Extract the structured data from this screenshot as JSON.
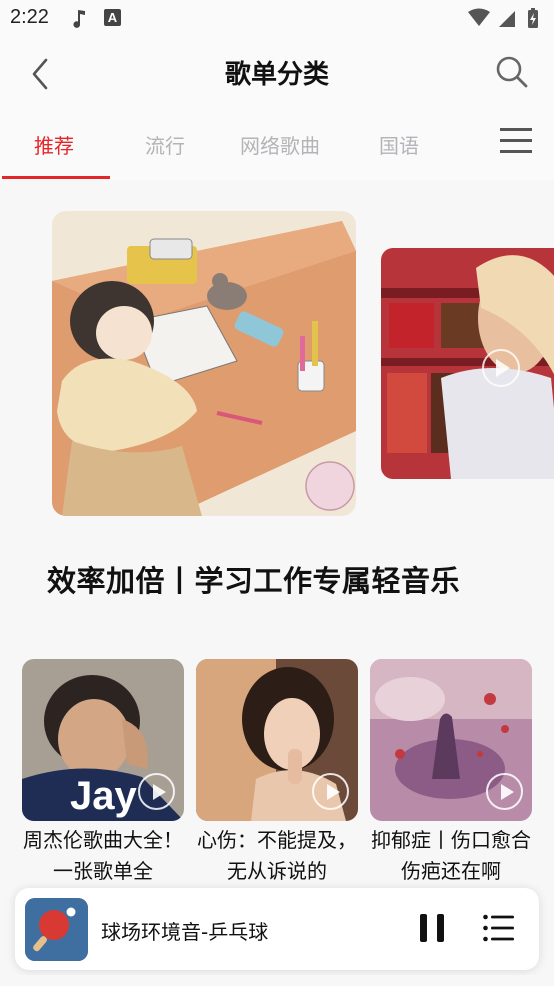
{
  "status_bar": {
    "time": "2:22",
    "badge": "A"
  },
  "header": {
    "title": "歌单分类"
  },
  "tabs": [
    {
      "label": "推荐",
      "active": true
    },
    {
      "label": "流行",
      "active": false
    },
    {
      "label": "网络歌曲",
      "active": false
    },
    {
      "label": "国语",
      "active": false
    }
  ],
  "banner": {
    "caption": "效率加倍丨学习工作专属轻音乐"
  },
  "playlists": [
    {
      "title": "周杰伦歌曲大全！一张歌单全"
    },
    {
      "title": "心伤：不能提及，无从诉说的"
    },
    {
      "title": "抑郁症丨伤口愈合伤疤还在啊"
    }
  ],
  "player": {
    "track": "球场环境音-乒乓球"
  },
  "colors": {
    "accent": "#e4262b",
    "tab_inactive": "#b4b4b8",
    "background": "#f7f7f8"
  },
  "icons": [
    "back-icon",
    "search-icon",
    "menu-icon",
    "play-icon",
    "pause-icon",
    "playlist-icon",
    "music-note-icon",
    "wifi-icon",
    "signal-icon",
    "battery-icon"
  ]
}
